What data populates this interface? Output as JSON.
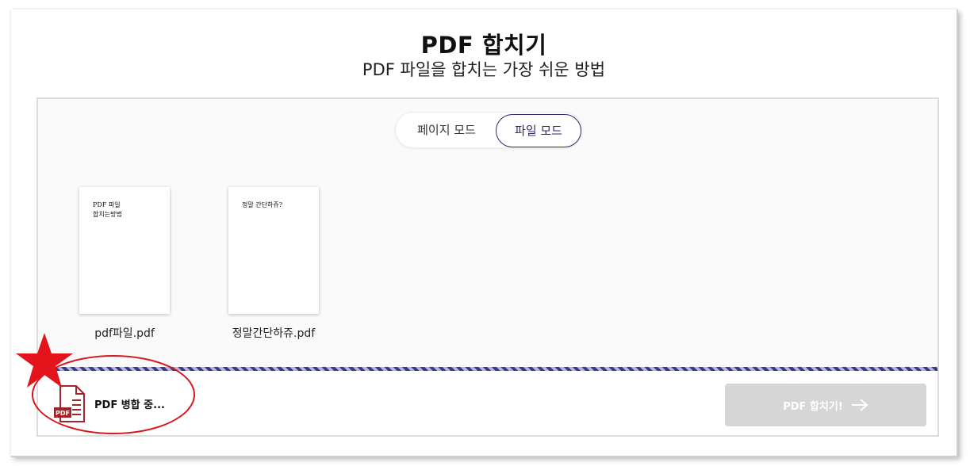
{
  "header": {
    "title": "PDF 합치기",
    "subtitle": "PDF 파일을 합치는 가장 쉬운 방법"
  },
  "mode_toggle": {
    "page_mode_label": "페이지 모드",
    "file_mode_label": "파일 모드",
    "selected": "file_mode"
  },
  "files": [
    {
      "name": "pdf파일.pdf",
      "preview_lines": [
        "PDF 파일",
        "합치는방법"
      ]
    },
    {
      "name": "정말간단하쥬.pdf",
      "preview_lines": [
        "정말 간단하쥬?"
      ]
    }
  ],
  "status": {
    "text": "PDF 병합 중...",
    "pdf_icon_label": "PDF"
  },
  "merge_button": {
    "label": "PDF 합치기!",
    "icon": "arrow-right-icon",
    "state": "disabled"
  },
  "colors": {
    "accent": "#2c2a6e",
    "stripe_dark": "#3b3a8a",
    "stripe_light": "#b7b3e0",
    "pdf_red": "#a3232a",
    "annotation_red": "#d9141b",
    "button_disabled": "#d6d6d6"
  },
  "annotations": {
    "star_icon": "red-star-icon",
    "circle": "red-ellipse-highlight"
  }
}
